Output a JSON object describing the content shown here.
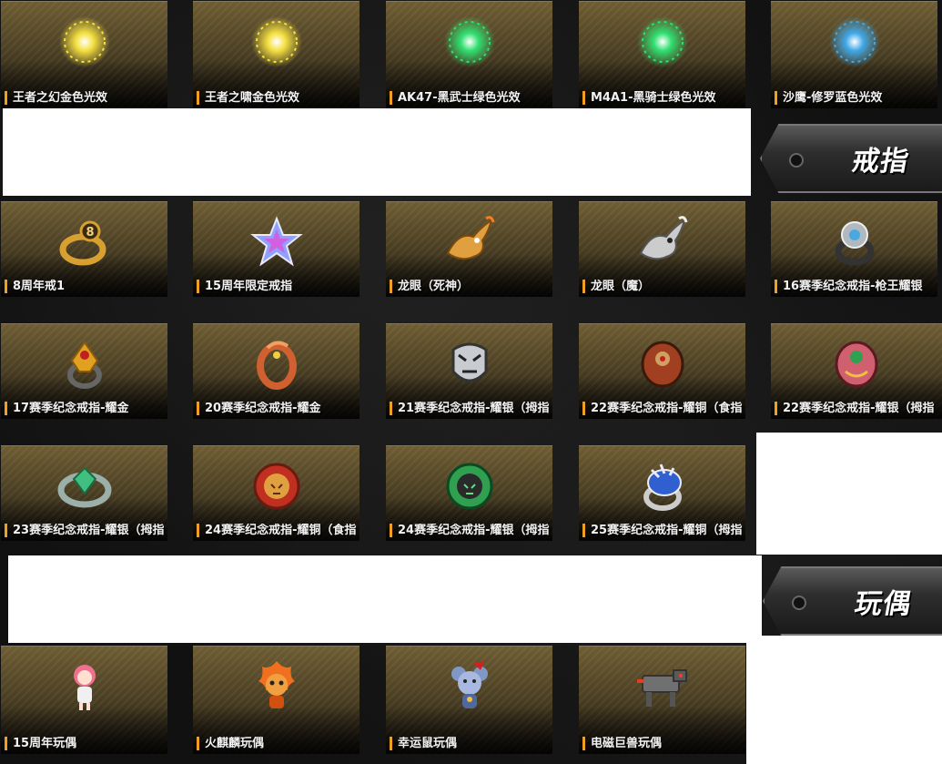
{
  "sections": {
    "effects": {
      "items": [
        {
          "label": "王者之幻金色光效",
          "icon": "gold-glow-effect-icon",
          "color": "#f5e040"
        },
        {
          "label": "王者之啸金色光效",
          "icon": "gold-glow-effect-icon",
          "color": "#f5e040"
        },
        {
          "label": "AK47-黑武士绿色光效",
          "icon": "green-glow-effect-icon",
          "color": "#30e070"
        },
        {
          "label": "M4A1-黑骑士绿色光效",
          "icon": "green-glow-effect-icon",
          "color": "#30e070"
        },
        {
          "label": "沙鹰-修罗蓝色光效",
          "icon": "blue-glow-effect-icon",
          "color": "#40a8e8"
        }
      ]
    },
    "rings": {
      "title": "戒指",
      "items": [
        {
          "label": "8周年戒1",
          "icon": "ring-icon",
          "color": "#d8a030"
        },
        {
          "label": "15周年限定戒指",
          "icon": "star-ring-icon",
          "color": "#8fa0ff"
        },
        {
          "label": "龙眼（死神）",
          "icon": "dragon-ring-icon",
          "color": "#e0a040"
        },
        {
          "label": "龙眼（魔）",
          "icon": "dragon-ring-icon",
          "color": "#cccccc"
        },
        {
          "label": "16赛季纪念戒指-枪王耀银",
          "icon": "ring-icon",
          "color": "#b0b8c0"
        },
        {
          "label": "17赛季纪念戒指-耀金",
          "icon": "ring-icon",
          "color": "#e0a020"
        },
        {
          "label": "20赛季纪念戒指-耀金",
          "icon": "dragon-ring-icon",
          "color": "#d06030"
        },
        {
          "label": "21赛季纪念戒指-耀银（拇指",
          "icon": "tiger-ring-icon",
          "color": "#c8ccd0"
        },
        {
          "label": "22赛季纪念戒指-耀铜（食指",
          "icon": "ring-icon",
          "color": "#a04020"
        },
        {
          "label": "22赛季纪念戒指-耀银（拇指",
          "icon": "ring-icon",
          "color": "#d06070"
        },
        {
          "label": "23赛季纪念戒指-耀银（拇指",
          "icon": "ring-icon",
          "color": "#40c080"
        },
        {
          "label": "24赛季纪念戒指-耀铜（食指",
          "icon": "lion-ring-icon",
          "color": "#c03020"
        },
        {
          "label": "24赛季纪念戒指-耀银（拇指",
          "icon": "lion-ring-icon",
          "color": "#30a050"
        },
        {
          "label": "25赛季纪念戒指-耀铜（拇指",
          "icon": "ring-icon",
          "color": "#3060d0"
        }
      ]
    },
    "dolls": {
      "title": "玩偶",
      "items": [
        {
          "label": "15周年玩偶",
          "icon": "doll-girl-icon",
          "color": "#f07090"
        },
        {
          "label": "火麒麟玩偶",
          "icon": "fire-qilin-doll-icon",
          "color": "#f07020"
        },
        {
          "label": "幸运鼠玩偶",
          "icon": "lucky-mouse-doll-icon",
          "color": "#8098c8"
        },
        {
          "label": "电磁巨兽玩偶",
          "icon": "mech-beast-doll-icon",
          "color": "#707070"
        }
      ]
    }
  }
}
